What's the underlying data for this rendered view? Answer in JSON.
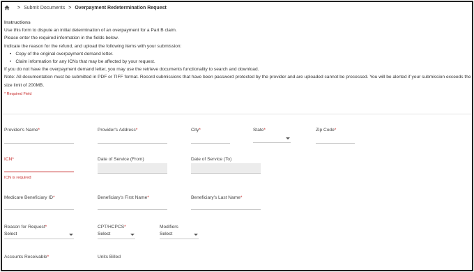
{
  "breadcrumb": {
    "home_icon": "home-icon",
    "items": [
      "Submit Documents",
      "Overpayment Redetermination Request"
    ],
    "separator": ">"
  },
  "instructions": {
    "heading": "Instructions",
    "lines": [
      "Use this form to dispute an initial determination of an overpayment for a Part B claim.",
      "Please enter the required information in the fields below.",
      "Indicate the reason for the refund, and upload the following items with your submission:"
    ],
    "bullets": [
      "Copy of the original overpayment demand letter.",
      "Claim information for any ICNs that may be affected by your request."
    ],
    "after": [
      "If you do not have the overpayment demand letter, you may use the retrieve documents functionality to search and download.",
      "Note: All documentation must be submitted in PDF or TIFF format. Record submissions that have been password protected by the provider and are uploaded cannot be processed. You will be alerted if your submission exceeds the size limit of 200MB."
    ],
    "required_note": "* Required Field"
  },
  "form": {
    "providers_name": "Provider's Name",
    "providers_address": "Provider's Address",
    "city": "City",
    "state": "State",
    "zip_code": "Zip Code",
    "icn": "ICN",
    "icn_error": "ICN is required",
    "dos_from": "Date of Service (From)",
    "dos_to": "Date of Service (To)",
    "medicare_id": "Medicare Beneficiary ID",
    "first_name": "Beneficiary's First Name",
    "last_name": "Beneficiary's Last Name",
    "reason": "Reason for Request",
    "cpt": "CPT/HCPCS",
    "modifiers": "Modifiers",
    "select_placeholder": "Select",
    "accounts_receivable": "Accounts Receivable",
    "units_billed": "Units Billed",
    "required_mark": "*"
  },
  "colors": {
    "required": "#c62828",
    "border": "#222222",
    "disabled_fill": "#ececec"
  }
}
